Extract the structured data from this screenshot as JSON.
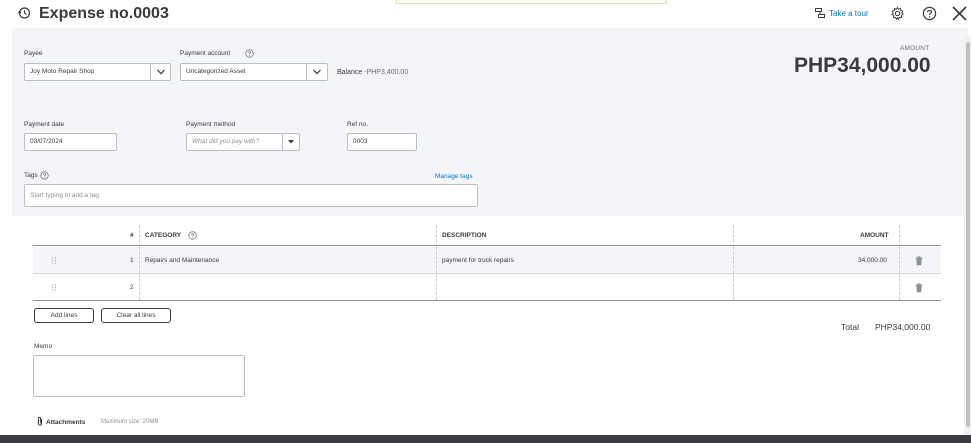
{
  "title": "Expense no.0003",
  "toolbar": {
    "tour_label": "Take a tour"
  },
  "header": {
    "payee_label": "Payee",
    "payee_value": "Joy Moto Repair Shop",
    "account_label": "Payment account",
    "account_value": "Uncategorized Asset",
    "balance_label": "Balance",
    "balance_value": "-PHP3,400.00",
    "amount_label": "AMOUNT",
    "amount_value": "PHP34,000.00",
    "date_label": "Payment date",
    "date_value": "03/07/2024",
    "method_label": "Payment method",
    "method_placeholder": "What did you pay with?",
    "ref_label": "Ref no.",
    "ref_value": "0003",
    "tags_label": "Tags",
    "manage_tags": "Manage tags",
    "tags_placeholder": "Start typing to add a tag"
  },
  "table": {
    "columns": [
      "#",
      "CATEGORY",
      "DESCRIPTION",
      "AMOUNT"
    ],
    "rows": [
      {
        "num": "1",
        "category": "Repairs and Maintenance",
        "description": "payment for truck repairs",
        "amount": "34,000.00"
      },
      {
        "num": "2",
        "category": "",
        "description": "",
        "amount": ""
      }
    ]
  },
  "buttons": {
    "add_lines": "Add lines",
    "clear_lines": "Clear all lines"
  },
  "totals": {
    "label": "Total",
    "value": "PHP34,000.00"
  },
  "memo": {
    "label": "Memo"
  },
  "attachments": {
    "label": "Attachments",
    "max_size": "Maximum size: 20MB"
  },
  "icons": [
    "history-icon",
    "tour-icon",
    "gear-icon",
    "help-icon",
    "close-icon",
    "info-icon",
    "chevron-down-icon",
    "drag-handle-icon",
    "trash-icon",
    "paperclip-icon"
  ],
  "colors": {
    "link": "#0077c5",
    "panel_bg": "#f4f5f8",
    "text": "#393a3d"
  }
}
